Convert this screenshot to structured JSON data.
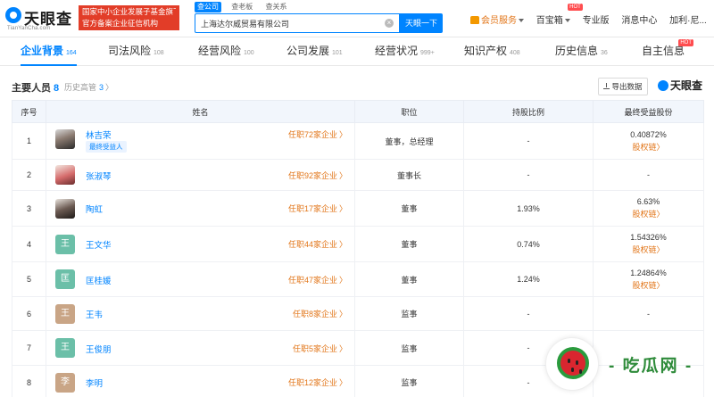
{
  "header": {
    "logo_text": "天眼查",
    "logo_sub": "TianYanCha.com",
    "promo_line1": "国家中小企业发展子基金旗下",
    "promo_line2": "官方备案企业征信机构",
    "search_tabs": [
      "查公司",
      "查老板",
      "查关系"
    ],
    "search_value": "上海达尔威贸易有限公司",
    "search_button": "天眼一下",
    "clear_icon_glyph": "×",
    "nav": {
      "vip": "会员服务",
      "baibao": "百宝箱",
      "pro": "专业版",
      "messages": "消息中心",
      "user": "加利·尼..."
    },
    "hot_label": "HOT"
  },
  "tabs": [
    {
      "label": "企业背景",
      "count": "164"
    },
    {
      "label": "司法风险",
      "count": "108"
    },
    {
      "label": "经营风险",
      "count": "100"
    },
    {
      "label": "公司发展",
      "count": "101"
    },
    {
      "label": "经营状况",
      "count": "999+"
    },
    {
      "label": "知识产权",
      "count": "408"
    },
    {
      "label": "历史信息",
      "count": "36"
    },
    {
      "label": "自主信息",
      "count": ""
    }
  ],
  "section": {
    "title": "主要人员",
    "count": "8",
    "history_label": "历史高管",
    "history_count": "3",
    "chevron": "〉",
    "export_label": "导出数据",
    "brand_watermark": "天眼查"
  },
  "table": {
    "headers": [
      "序号",
      "姓名",
      "职位",
      "持股比例",
      "最终受益股份"
    ],
    "rows": [
      {
        "idx": "1",
        "avatar": "",
        "name": "林吉荣",
        "tag": "最终受益人",
        "jobs": "任职72家企业",
        "position": "董事，总经理",
        "ratio": "-",
        "ben": "0.40872%",
        "ben_link": "股权链"
      },
      {
        "idx": "2",
        "avatar": "",
        "name": "张淑琴",
        "tag": "",
        "jobs": "任职92家企业",
        "position": "董事长",
        "ratio": "-",
        "ben": "-",
        "ben_link": ""
      },
      {
        "idx": "3",
        "avatar": "",
        "name": "陶虹",
        "tag": "",
        "jobs": "任职17家企业",
        "position": "董事",
        "ratio": "1.93%",
        "ben": "6.63%",
        "ben_link": "股权链"
      },
      {
        "idx": "4",
        "avatar": "王",
        "name": "王文华",
        "tag": "",
        "jobs": "任职44家企业",
        "position": "董事",
        "ratio": "0.74%",
        "ben": "1.54326%",
        "ben_link": "股权链"
      },
      {
        "idx": "5",
        "avatar": "匡",
        "name": "匡桂媛",
        "tag": "",
        "jobs": "任职47家企业",
        "position": "董事",
        "ratio": "1.24%",
        "ben": "1.24864%",
        "ben_link": "股权链"
      },
      {
        "idx": "6",
        "avatar": "王",
        "name": "王韦",
        "tag": "",
        "jobs": "任职8家企业",
        "position": "监事",
        "ratio": "-",
        "ben": "-",
        "ben_link": ""
      },
      {
        "idx": "7",
        "avatar": "王",
        "name": "王俊朋",
        "tag": "",
        "jobs": "任职5家企业",
        "position": "监事",
        "ratio": "-",
        "ben": "",
        "ben_link": ""
      },
      {
        "idx": "8",
        "avatar": "李",
        "name": "李明",
        "tag": "",
        "jobs": "任职12家企业",
        "position": "监事",
        "ratio": "-",
        "ben": "",
        "ben_link": ""
      }
    ]
  },
  "watermark": {
    "text": "- 吃瓜网 -"
  },
  "colors": {
    "primary": "#0084ff",
    "orange": "#e2761a",
    "promo_red": "#e23d28",
    "header_bg": "#f2f6fc"
  }
}
